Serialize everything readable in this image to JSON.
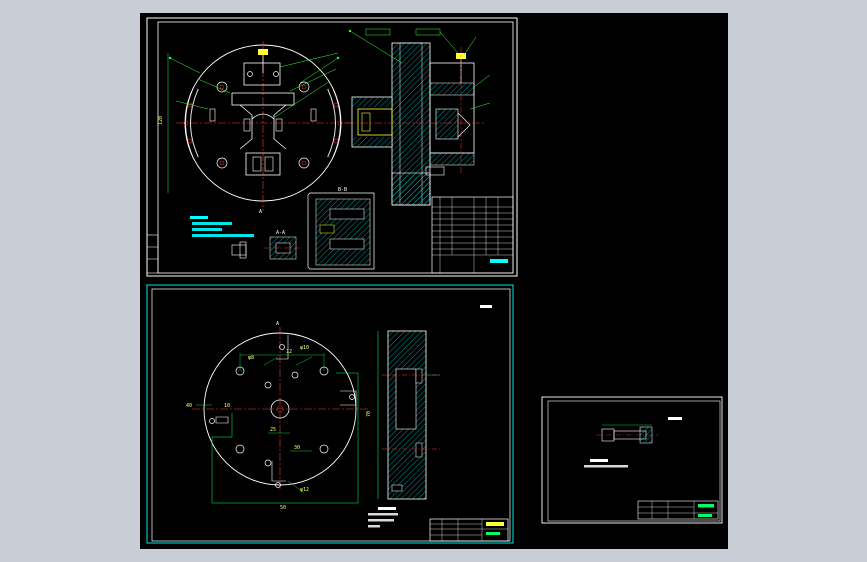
{
  "app": {
    "background_color": "#c9ced6",
    "model_space_color": "#000000"
  },
  "colors": {
    "border_white": "#ffffff",
    "border_cyan": "#00e5e5",
    "outline": "#ffffff",
    "center_line": "#ff3333",
    "dimension": "#00ff66",
    "hatch": "#00cccc",
    "note_text": "#00ffff",
    "leader": "#33ff33",
    "part_yellow": "#ffff33"
  },
  "sheets": [
    {
      "id": "assembly-sheet",
      "title_block_rows": 14
    },
    {
      "id": "plate-sheet",
      "title_block_rows": 4
    },
    {
      "id": "pin-sheet",
      "title_block_rows": 3
    }
  ],
  "annotations": {
    "dim_70": "70",
    "dim_40": "40",
    "dim_12": "12",
    "dim_10": "10",
    "dim_50": "50",
    "dim_30": "30",
    "dim_25": "25",
    "dim_120": "120",
    "dim_d10": "φ10",
    "dim_d8": "φ8",
    "dim_d12": "φ12"
  }
}
